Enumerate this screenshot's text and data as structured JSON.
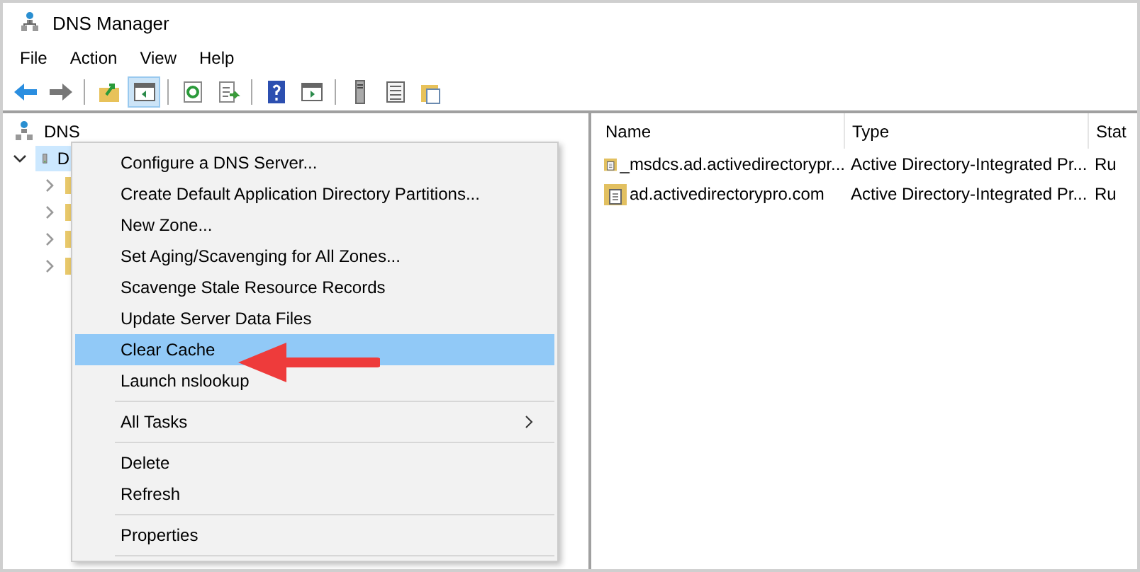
{
  "window": {
    "title": "DNS Manager"
  },
  "menu_bar": [
    "File",
    "Action",
    "View",
    "Help"
  ],
  "toolbar": [
    [
      {
        "selected": false
      },
      {
        "selected": false
      }
    ],
    [
      {
        "selected": false
      },
      {
        "selected": true
      }
    ],
    [
      {
        "selected": false
      },
      {
        "selected": false
      }
    ],
    [
      {
        "selected": false
      },
      {
        "selected": false
      }
    ],
    [
      {
        "selected": false
      },
      {
        "selected": false
      },
      {
        "selected": false
      }
    ]
  ],
  "tree": {
    "label": "DNS",
    "children": [
      {
        "label": "D",
        "expanded": true,
        "selected": true,
        "children": [
          {
            "expanded": false
          },
          {
            "expanded": false
          },
          {
            "expanded": false
          },
          {
            "expanded": false
          }
        ]
      }
    ]
  },
  "context_menu": {
    "groups": [
      [
        {
          "label": "Configure a DNS Server...",
          "selected": false,
          "submenu": false
        },
        {
          "label": "Create Default Application Directory Partitions...",
          "selected": false,
          "submenu": false
        },
        {
          "label": "New Zone...",
          "selected": false,
          "submenu": false
        },
        {
          "label": "Set Aging/Scavenging for All Zones...",
          "selected": false,
          "submenu": false
        },
        {
          "label": "Scavenge Stale Resource Records",
          "selected": false,
          "submenu": false
        },
        {
          "label": "Update Server Data Files",
          "selected": false,
          "submenu": false
        },
        {
          "label": "Clear Cache",
          "selected": true,
          "submenu": false
        },
        {
          "label": "Launch nslookup",
          "selected": false,
          "submenu": false
        }
      ],
      [
        {
          "label": "All Tasks",
          "selected": false,
          "submenu": true
        }
      ],
      [
        {
          "label": "Delete",
          "selected": false,
          "submenu": false
        },
        {
          "label": "Refresh",
          "selected": false,
          "submenu": false
        }
      ],
      [
        {
          "label": "Properties",
          "selected": false,
          "submenu": false
        }
      ]
    ]
  },
  "table": {
    "columns": [
      "Name",
      "Type",
      "Stat"
    ],
    "rows": [
      [
        "_msdcs.ad.activedirectorypr...",
        "Active Directory-Integrated Pr...",
        "Ru"
      ],
      [
        "ad.activedirectorypro.com",
        "Active Directory-Integrated Pr...",
        "Ru"
      ]
    ]
  }
}
